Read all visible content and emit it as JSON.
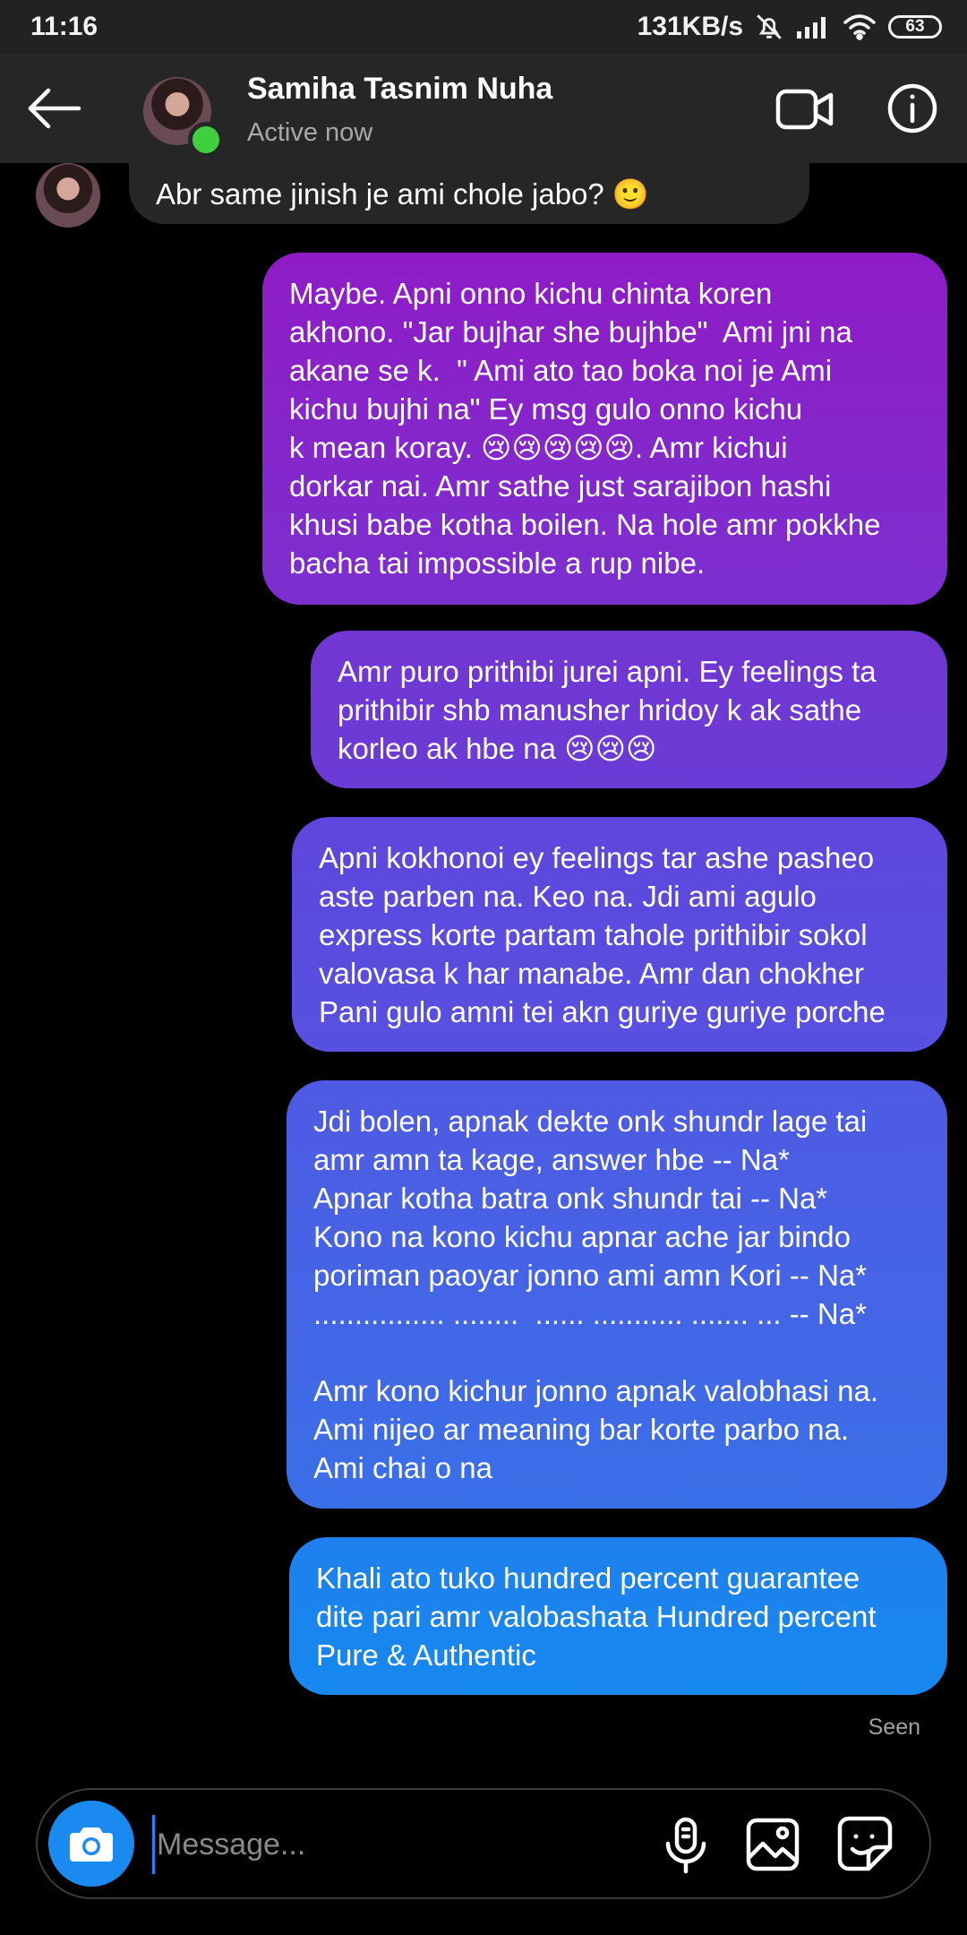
{
  "status_bar": {
    "time": "11:16",
    "network_speed": "131KB/s",
    "battery_level": "63",
    "icons": [
      "mute-icon",
      "signal-icon",
      "wifi-icon",
      "battery-icon"
    ]
  },
  "header": {
    "contact_name": "Samiha Tasnim Nuha",
    "contact_status": "Active now",
    "icons": [
      "back-arrow-icon",
      "video-call-icon",
      "info-icon"
    ]
  },
  "messages": {
    "incoming": [
      {
        "text": "Abr same jinish je ami chole jabo? 🙂"
      }
    ],
    "outgoing": [
      {
        "text": "Maybe. Apni onno kichu chinta koren\nakhono. \"Jar bujhar she bujhbe\"  Ami jni na\nakane se k.  \" Ami ato tao boka noi je Ami\nkichu bujhi na\" Ey msg gulo onno kichu\nk mean koray. 😢😢😢😢😢. Amr kichui\ndorkar nai. Amr sathe just sarajibon hashi\nkhusi babe kotha boilen. Na hole amr pokkhe\nbacha tai impossible a rup nibe."
      },
      {
        "text": "Amr puro prithibi jurei apni. Ey feelings ta\nprithibir shb manusher hridoy k ak sathe\nkorleo ak hbe na 😢😢😢"
      },
      {
        "text": "Apni kokhonoi ey feelings tar ashe pasheo\naste parben na. Keo na. Jdi ami agulo\nexpress korte partam tahole prithibir sokol\nvalovasa k har manabe. Amr dan chokher\nPani gulo amni tei akn guriye guriye porche"
      },
      {
        "text": "Jdi bolen, apnak dekte onk shundr lage tai\namr amn ta kage, answer hbe -- Na*\nApnar kotha batra onk shundr tai -- Na*\nKono na kono kichu apnar ache jar bindo\nporiman paoyar jonno ami amn Kori -- Na*\n................ ........  ...... ........... ....... ... -- Na*\n\nAmr kono kichur jonno apnak valobhasi na.\nAmi nijeo ar meaning bar korte parbo na.\nAmi chai o na"
      },
      {
        "text": "Khali ato tuko hundred percent guarantee\ndite pari amr valobashata Hundred percent\nPure & Authentic"
      }
    ],
    "seen_label": "Seen"
  },
  "composer": {
    "placeholder": "Message...",
    "value": "",
    "icons": [
      "camera-icon",
      "microphone-icon",
      "gallery-icon",
      "sticker-icon"
    ]
  },
  "colors": {
    "accent": "#1a8af0",
    "online": "#3fcf3f",
    "incoming_bubble": "#262626",
    "header_bg": "#262626"
  }
}
